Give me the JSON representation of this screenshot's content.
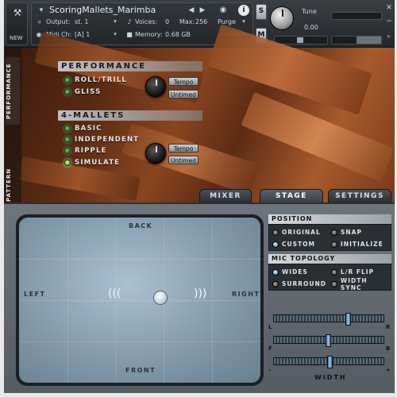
{
  "header": {
    "instrument_name": "ScoringMallets_Marimba",
    "output_label": "Output:",
    "output_value": "st. 1",
    "midi_label": "Midi Ch:",
    "midi_value": "[A]  1",
    "voices_label": "Voices:",
    "voices_value": "0",
    "max_label": "Max:",
    "max_value": "256",
    "memory_label": "Memory:",
    "memory_value": "0.68 GB",
    "purge_label": "Purge",
    "tune_label": "Tune",
    "tune_value": "0.00",
    "new_label": "NEW",
    "s_label": "S",
    "m_label": "M"
  },
  "side_tabs": {
    "performance": "PERFORMANCE",
    "pattern": "PATTERN"
  },
  "performance": {
    "title": "PERFORMANCE",
    "options": [
      "ROLL/TRILL",
      "GLISS"
    ],
    "pills": [
      "Tempo",
      "Untimed"
    ]
  },
  "mallets": {
    "title": "4-MALLETS",
    "options": [
      "BASIC",
      "INDEPENDENT",
      "RIPPLE",
      "SIMULATE"
    ],
    "pills": [
      "Tempo",
      "Untimed"
    ]
  },
  "tabs": [
    "MIXER",
    "STAGE",
    "SETTINGS"
  ],
  "stage": {
    "back": "BACK",
    "front": "FRONT",
    "left": "LEFT",
    "right": "RIGHT"
  },
  "position": {
    "title": "POSITION",
    "options": [
      "ORIGINAL",
      "SNAP",
      "CUSTOM",
      "INITIALIZE"
    ]
  },
  "mic": {
    "title": "MIC TOPOLOGY",
    "options": [
      "WIDES",
      "L/R FLIP",
      "SURROUND",
      "WIDTH SYNC"
    ]
  },
  "sliders": {
    "pan": {
      "left": "L",
      "right": "R",
      "value": 0.7
    },
    "depth": {
      "left": "F",
      "right": "B",
      "value": 0.5
    },
    "width": {
      "left": "-",
      "right": "+",
      "label": "WIDTH",
      "value": 0.52
    }
  },
  "colors": {
    "accent_led": "#62c03a",
    "radio_on": "#4a86c8"
  }
}
